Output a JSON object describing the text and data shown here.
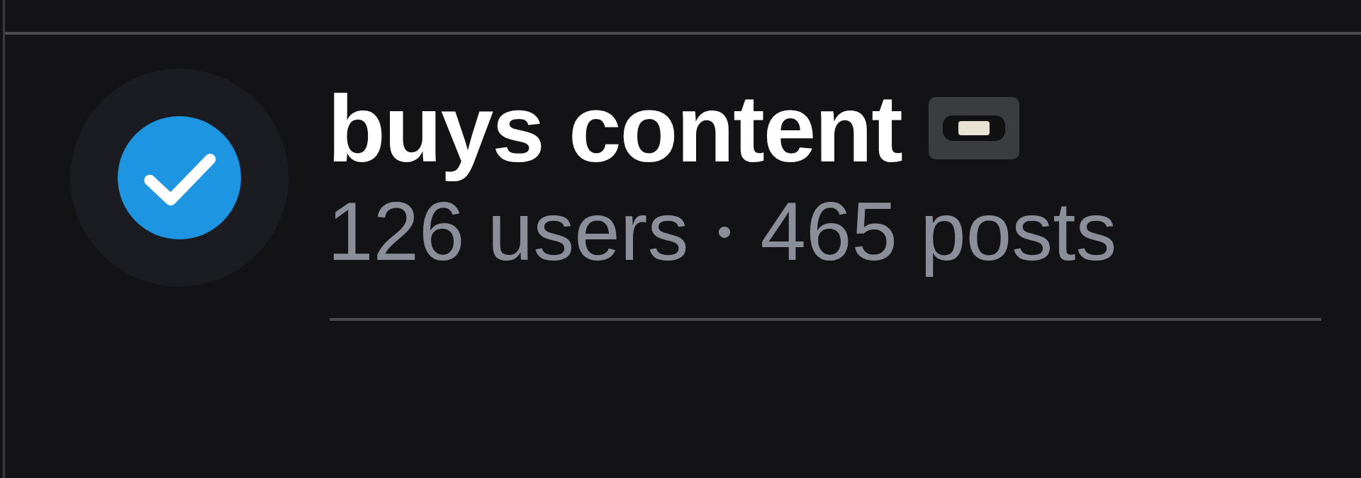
{
  "list_item": {
    "verified": true,
    "title": "buys content",
    "stats": [
      {
        "text": "126 users"
      },
      {
        "text": "465 posts"
      }
    ],
    "separator": "•"
  }
}
